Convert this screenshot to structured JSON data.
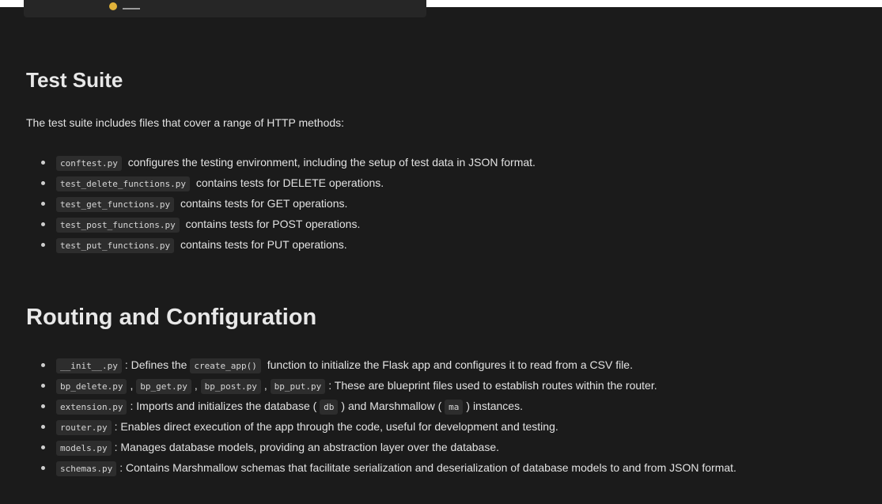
{
  "test_suite": {
    "heading": "Test Suite",
    "intro": "The test suite includes files that cover a range of HTTP methods:",
    "items": [
      {
        "code": "conftest.py",
        "text": "configures the testing environment, including the setup of test data in JSON format."
      },
      {
        "code": "test_delete_functions.py",
        "text": "contains tests for DELETE operations."
      },
      {
        "code": "test_get_functions.py",
        "text": "contains tests for GET operations."
      },
      {
        "code": "test_post_functions.py",
        "text": "contains tests for POST operations."
      },
      {
        "code": "test_put_functions.py",
        "text": "contains tests for PUT operations."
      }
    ]
  },
  "routing": {
    "heading": "Routing and Configuration",
    "items": [
      {
        "code1": "__init__.py",
        "text1": ": Defines the",
        "code2": "create_app()",
        "text2": "function to initialize the Flask app and configures it to read from a CSV file."
      },
      {
        "code1": "bp_delete.py",
        "sep1": ",",
        "code2": "bp_get.py",
        "sep2": ",",
        "code3": "bp_post.py",
        "sep3": ",",
        "code4": "bp_put.py",
        "text": ": These are blueprint files used to establish routes within the router."
      },
      {
        "code1": "extension.py",
        "text1": ": Imports and initializes the database (",
        "code2": "db",
        "text2": ") and Marshmallow (",
        "code3": "ma",
        "text3": ") instances."
      },
      {
        "code": "router.py",
        "text": ": Enables direct execution of the app through the code, useful for development and testing."
      },
      {
        "code": "models.py",
        "text": ": Manages database models, providing an abstraction layer over the database."
      },
      {
        "code": "schemas.py",
        "text": ": Contains Marshmallow schemas that facilitate serialization and deserialization of database models to and from JSON format."
      }
    ]
  }
}
